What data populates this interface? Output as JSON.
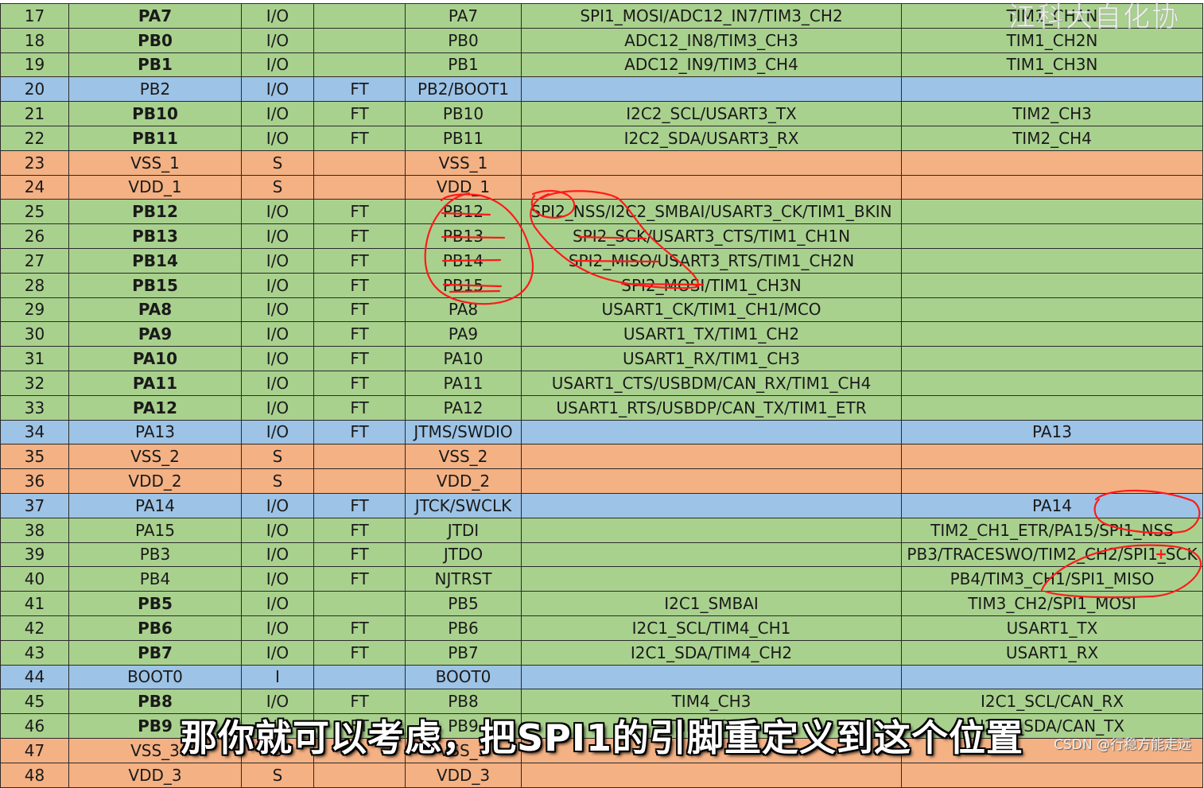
{
  "colors": {
    "green": "#a9d18e",
    "blue": "#9dc3e6",
    "orange": "#f4b183",
    "annotation_red": "#ff1a1a"
  },
  "rows": [
    {
      "num": "17",
      "name": "PA7",
      "type": "I/O",
      "level": "",
      "main": "PA7",
      "default_alt": "SPI1_MOSI/ADC12_IN7/TIM3_CH2",
      "remap": "TIM1_CH1N",
      "color": "green",
      "bold": true
    },
    {
      "num": "18",
      "name": "PB0",
      "type": "I/O",
      "level": "",
      "main": "PB0",
      "default_alt": "ADC12_IN8/TIM3_CH3",
      "remap": "TIM1_CH2N",
      "color": "green",
      "bold": true
    },
    {
      "num": "19",
      "name": "PB1",
      "type": "I/O",
      "level": "",
      "main": "PB1",
      "default_alt": "ADC12_IN9/TIM3_CH4",
      "remap": "TIM1_CH3N",
      "color": "green",
      "bold": true
    },
    {
      "num": "20",
      "name": "PB2",
      "type": "I/O",
      "level": "FT",
      "main": "PB2/BOOT1",
      "default_alt": "",
      "remap": "",
      "color": "blue",
      "bold": false
    },
    {
      "num": "21",
      "name": "PB10",
      "type": "I/O",
      "level": "FT",
      "main": "PB10",
      "default_alt": "I2C2_SCL/USART3_TX",
      "remap": "TIM2_CH3",
      "color": "green",
      "bold": true
    },
    {
      "num": "22",
      "name": "PB11",
      "type": "I/O",
      "level": "FT",
      "main": "PB11",
      "default_alt": "I2C2_SDA/USART3_RX",
      "remap": "TIM2_CH4",
      "color": "green",
      "bold": true
    },
    {
      "num": "23",
      "name": "VSS_1",
      "type": "S",
      "level": "",
      "main": "VSS_1",
      "default_alt": "",
      "remap": "",
      "color": "orange",
      "bold": false
    },
    {
      "num": "24",
      "name": "VDD_1",
      "type": "S",
      "level": "",
      "main": "VDD_1",
      "default_alt": "",
      "remap": "",
      "color": "orange",
      "bold": false
    },
    {
      "num": "25",
      "name": "PB12",
      "type": "I/O",
      "level": "FT",
      "main": "PB12",
      "default_alt": "SPI2_NSS/I2C2_SMBAI/USART3_CK/TIM1_BKIN",
      "remap": "",
      "color": "green",
      "bold": true
    },
    {
      "num": "26",
      "name": "PB13",
      "type": "I/O",
      "level": "FT",
      "main": "PB13",
      "default_alt": "SPI2_SCK/USART3_CTS/TIM1_CH1N",
      "remap": "",
      "color": "green",
      "bold": true
    },
    {
      "num": "27",
      "name": "PB14",
      "type": "I/O",
      "level": "FT",
      "main": "PB14",
      "default_alt": "SPI2_MISO/USART3_RTS/TIM1_CH2N",
      "remap": "",
      "color": "green",
      "bold": true
    },
    {
      "num": "28",
      "name": "PB15",
      "type": "I/O",
      "level": "FT",
      "main": "PB15",
      "default_alt": "SPI2_MOSI/TIM1_CH3N",
      "remap": "",
      "color": "green",
      "bold": true
    },
    {
      "num": "29",
      "name": "PA8",
      "type": "I/O",
      "level": "FT",
      "main": "PA8",
      "default_alt": "USART1_CK/TIM1_CH1/MCO",
      "remap": "",
      "color": "green",
      "bold": true
    },
    {
      "num": "30",
      "name": "PA9",
      "type": "I/O",
      "level": "FT",
      "main": "PA9",
      "default_alt": "USART1_TX/TIM1_CH2",
      "remap": "",
      "color": "green",
      "bold": true
    },
    {
      "num": "31",
      "name": "PA10",
      "type": "I/O",
      "level": "FT",
      "main": "PA10",
      "default_alt": "USART1_RX/TIM1_CH3",
      "remap": "",
      "color": "green",
      "bold": true
    },
    {
      "num": "32",
      "name": "PA11",
      "type": "I/O",
      "level": "FT",
      "main": "PA11",
      "default_alt": "USART1_CTS/USBDM/CAN_RX/TIM1_CH4",
      "remap": "",
      "color": "green",
      "bold": true
    },
    {
      "num": "33",
      "name": "PA12",
      "type": "I/O",
      "level": "FT",
      "main": "PA12",
      "default_alt": "USART1_RTS/USBDP/CAN_TX/TIM1_ETR",
      "remap": "",
      "color": "green",
      "bold": true
    },
    {
      "num": "34",
      "name": "PA13",
      "type": "I/O",
      "level": "FT",
      "main": "JTMS/SWDIO",
      "default_alt": "",
      "remap": "PA13",
      "color": "blue",
      "bold": false
    },
    {
      "num": "35",
      "name": "VSS_2",
      "type": "S",
      "level": "",
      "main": "VSS_2",
      "default_alt": "",
      "remap": "",
      "color": "orange",
      "bold": false
    },
    {
      "num": "36",
      "name": "VDD_2",
      "type": "S",
      "level": "",
      "main": "VDD_2",
      "default_alt": "",
      "remap": "",
      "color": "orange",
      "bold": false
    },
    {
      "num": "37",
      "name": "PA14",
      "type": "I/O",
      "level": "FT",
      "main": "JTCK/SWCLK",
      "default_alt": "",
      "remap": "PA14",
      "color": "blue",
      "bold": false
    },
    {
      "num": "38",
      "name": "PA15",
      "type": "I/O",
      "level": "FT",
      "main": "JTDI",
      "default_alt": "",
      "remap": "TIM2_CH1_ETR/PA15/SPI1_NSS",
      "color": "green",
      "bold": false
    },
    {
      "num": "39",
      "name": "PB3",
      "type": "I/O",
      "level": "FT",
      "main": "JTDO",
      "default_alt": "",
      "remap": "PB3/TRACESWO/TIM2_CH2/SPI1_SCK",
      "color": "green",
      "bold": false
    },
    {
      "num": "40",
      "name": "PB4",
      "type": "I/O",
      "level": "FT",
      "main": "NJTRST",
      "default_alt": "",
      "remap": "PB4/TIM3_CH1/SPI1_MISO",
      "color": "green",
      "bold": false
    },
    {
      "num": "41",
      "name": "PB5",
      "type": "I/O",
      "level": "",
      "main": "PB5",
      "default_alt": "I2C1_SMBAI",
      "remap": "TIM3_CH2/SPI1_MOSI",
      "color": "green",
      "bold": true
    },
    {
      "num": "42",
      "name": "PB6",
      "type": "I/O",
      "level": "FT",
      "main": "PB6",
      "default_alt": "I2C1_SCL/TIM4_CH1",
      "remap": "USART1_TX",
      "color": "green",
      "bold": true
    },
    {
      "num": "43",
      "name": "PB7",
      "type": "I/O",
      "level": "FT",
      "main": "PB7",
      "default_alt": "I2C1_SDA/TIM4_CH2",
      "remap": "USART1_RX",
      "color": "green",
      "bold": true
    },
    {
      "num": "44",
      "name": "BOOT0",
      "type": "I",
      "level": "",
      "main": "BOOT0",
      "default_alt": "",
      "remap": "",
      "color": "blue",
      "bold": false
    },
    {
      "num": "45",
      "name": "PB8",
      "type": "I/O",
      "level": "FT",
      "main": "PB8",
      "default_alt": "TIM4_CH3",
      "remap": "I2C1_SCL/CAN_RX",
      "color": "green",
      "bold": true
    },
    {
      "num": "46",
      "name": "PB9",
      "type": "I/O",
      "level": "FT",
      "main": "PB9",
      "default_alt": "TIM4_CH4",
      "remap": "I2C1_SDA/CAN_TX",
      "color": "green",
      "bold": true
    },
    {
      "num": "47",
      "name": "VSS_3",
      "type": "S",
      "level": "",
      "main": "VSS_3",
      "default_alt": "",
      "remap": "",
      "color": "orange",
      "bold": false
    },
    {
      "num": "48",
      "name": "VDD_3",
      "type": "S",
      "level": "",
      "main": "VDD_3",
      "default_alt": "",
      "remap": "",
      "color": "orange",
      "bold": false
    }
  ],
  "overlay": {
    "top_watermark": "江科大自化协",
    "subtitle": "那你就可以考虑，把SPI1的引脚重定义到这个位置",
    "csdn_watermark": "CSDN @行稳方能走远"
  }
}
